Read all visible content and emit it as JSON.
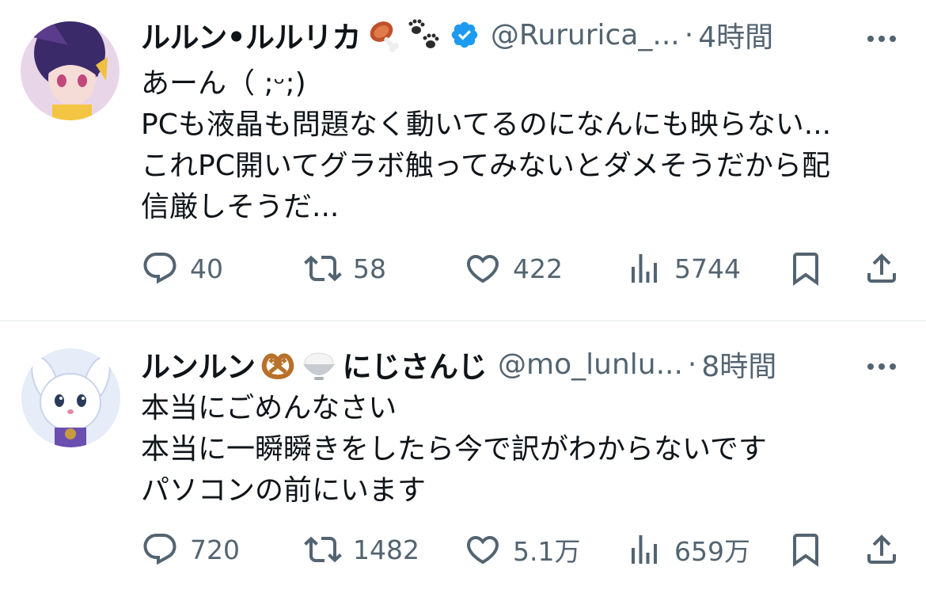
{
  "tweets": [
    {
      "display_name": "ルルン•ルルリカ",
      "name_emojis": [
        "meat-on-bone-emoji",
        "paw-prints-emoji"
      ],
      "verified": true,
      "handle": "@Rururica_...",
      "separator": "·",
      "time": "4時間",
      "body": "あーん（ ;ᵕ;)\nPCも液晶も問題なく動いてるのになんにも映らない...\nこれPC開いてグラボ触ってみないとダメそうだから配\n信厳しそうだ...",
      "replies": "40",
      "retweets": "58",
      "likes": "422",
      "views": "5744"
    },
    {
      "display_name_prefix": "ルンルン",
      "name_emojis": [
        "pretzel-emoji",
        "rice-bowl-emoji"
      ],
      "display_name_suffix": "にじさんじ",
      "verified": false,
      "handle": "@mo_lunlu...",
      "separator": "·",
      "time": "8時間",
      "body": "本当にごめんなさい\n本当に一瞬瞬きをしたら今で訳がわからないです\nパソコンの前にいます",
      "replies": "720",
      "retweets": "1482",
      "likes": "5.1万",
      "views": "659万"
    }
  ],
  "icons": {
    "reply": "speech-bubble-icon",
    "retweet": "retweet-arrows-icon",
    "like": "heart-icon",
    "views": "bar-chart-icon",
    "bookmark": "bookmark-icon",
    "share": "share-upload-icon",
    "more": "more-dots-icon",
    "verified": "verified-badge-icon"
  },
  "colors": {
    "text": "#0f1419",
    "secondary": "#536471",
    "verified_blue": "#1d9bf0",
    "divider": "#eff3f4"
  }
}
